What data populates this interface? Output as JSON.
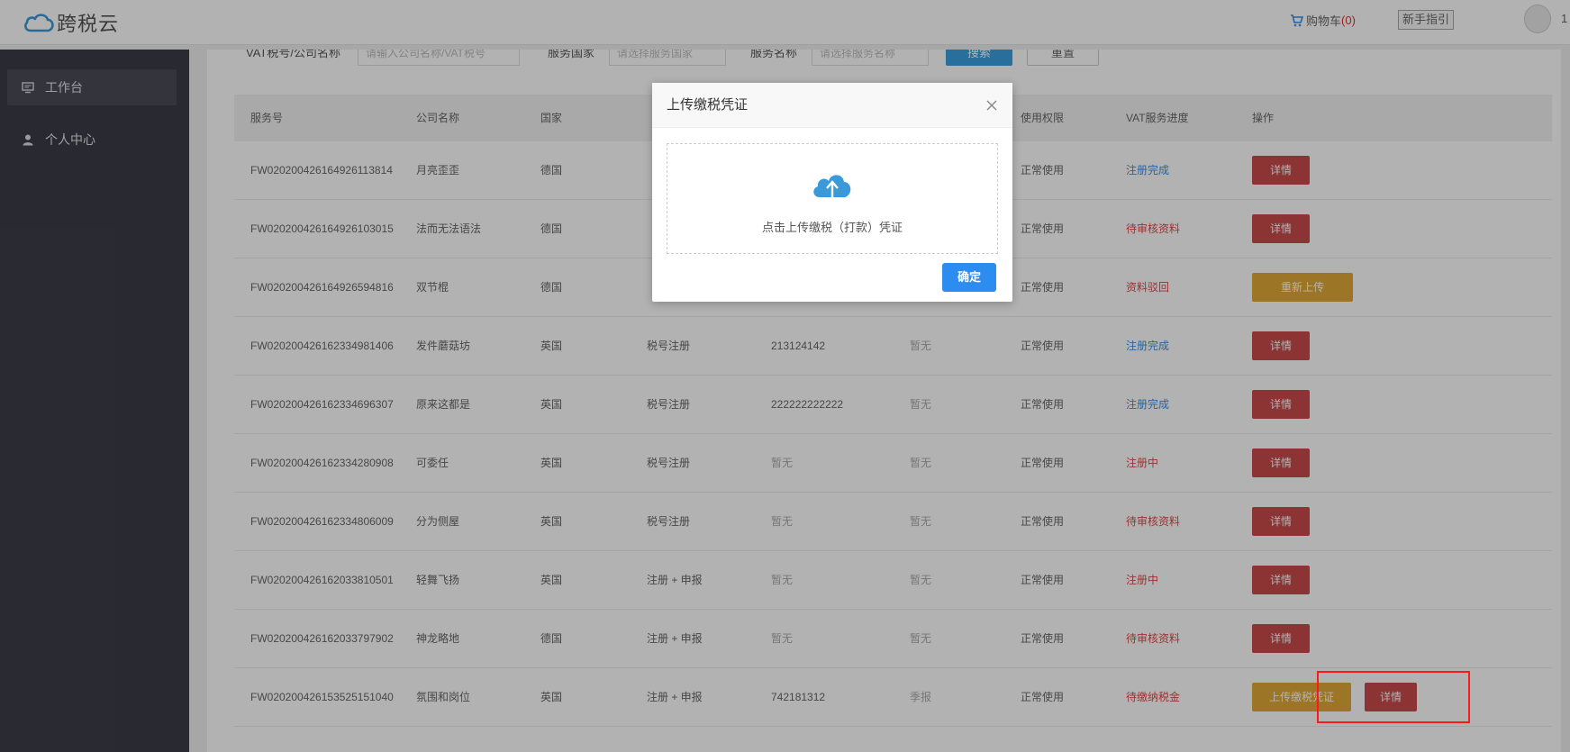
{
  "app": {
    "name": "跨税云"
  },
  "topbar": {
    "cart_label": "购物车",
    "cart_count": "(0)",
    "guide_label": "新手指引",
    "user_num": "1"
  },
  "sidebar": {
    "items": [
      {
        "label": "工作台",
        "active": true
      },
      {
        "label": "个人中心",
        "active": false
      }
    ]
  },
  "filter": {
    "vat_label": "VAT税号/公司名称",
    "vat_placeholder": "请输入公司名称/VAT税号",
    "country_label": "服务国家",
    "country_placeholder": "请选择服务国家",
    "service_label": "服务名称",
    "service_placeholder": "请选择服务名称",
    "search_label": "搜索",
    "reset_label": "重置"
  },
  "table": {
    "columns": [
      "服务号",
      "公司名称",
      "国家",
      "",
      "",
      "",
      "使用权限",
      "VAT服务进度",
      "操作"
    ],
    "rows": [
      {
        "id": "FW020200426164926113814",
        "company": "月亮歪歪",
        "country": "德国",
        "service": "",
        "vat": "",
        "vat_muted": false,
        "report": "",
        "permission": "正常使用",
        "progress": "注册完成",
        "progress_color": "blue",
        "action": "详情"
      },
      {
        "id": "FW020200426164926103015",
        "company": "法而无法语法",
        "country": "德国",
        "service": "",
        "vat": "",
        "vat_muted": false,
        "report": "",
        "permission": "正常使用",
        "progress": "待审核资料",
        "progress_color": "red",
        "action": "详情"
      },
      {
        "id": "FW020200426164926594816",
        "company": "双节棍",
        "country": "德国",
        "service": "",
        "vat": "",
        "vat_muted": false,
        "report": "",
        "permission": "正常使用",
        "progress": "资料驳回",
        "progress_color": "red",
        "action": "重新上传"
      },
      {
        "id": "FW020200426162334981406",
        "company": "发件蘑菇坊",
        "country": "英国",
        "service": "税号注册",
        "vat": "213124142",
        "vat_muted": false,
        "report": "暂无",
        "permission": "正常使用",
        "progress": "注册完成",
        "progress_color": "blue",
        "action": "详情"
      },
      {
        "id": "FW020200426162334696307",
        "company": "原来这都是",
        "country": "英国",
        "service": "税号注册",
        "vat": "222222222222",
        "vat_muted": false,
        "report": "暂无",
        "permission": "正常使用",
        "progress": "注册完成",
        "progress_color": "blue",
        "action": "详情"
      },
      {
        "id": "FW020200426162334280908",
        "company": "可委任",
        "country": "英国",
        "service": "税号注册",
        "vat": "暂无",
        "vat_muted": true,
        "report": "暂无",
        "permission": "正常使用",
        "progress": "注册中",
        "progress_color": "red",
        "action": "详情"
      },
      {
        "id": "FW020200426162334806009",
        "company": "分为侧屋",
        "country": "英国",
        "service": "税号注册",
        "vat": "暂无",
        "vat_muted": true,
        "report": "暂无",
        "permission": "正常使用",
        "progress": "待审核资料",
        "progress_color": "red",
        "action": "详情"
      },
      {
        "id": "FW020200426162033810501",
        "company": "轻舞飞扬",
        "country": "英国",
        "service": "注册 + 申报",
        "vat": "暂无",
        "vat_muted": true,
        "report": "暂无",
        "permission": "正常使用",
        "progress": "注册中",
        "progress_color": "red",
        "action": "详情"
      },
      {
        "id": "FW020200426162033797902",
        "company": "神龙略地",
        "country": "德国",
        "service": "注册 + 申报",
        "vat": "暂无",
        "vat_muted": true,
        "report": "暂无",
        "permission": "正常使用",
        "progress": "待审核资料",
        "progress_color": "red",
        "action": "详情"
      },
      {
        "id": "FW020200426153525151040",
        "company": "氛围和岗位",
        "country": "英国",
        "service": "注册 + 申报",
        "vat": "742181312",
        "vat_muted": false,
        "report": "季报",
        "permission": "正常使用",
        "progress": "待缴纳税金",
        "progress_color": "red",
        "action": "上传缴税凭证",
        "action2": "详情"
      }
    ]
  },
  "modal": {
    "title": "上传缴税凭证",
    "upload_hint": "点击上传缴税（打款）凭证",
    "confirm_label": "确定"
  },
  "colors": {
    "accent": "#2d8cf0",
    "detail_btn": "#c94b4b",
    "upload_btn": "#e0a838",
    "sidebar_bg": "#3c3d47",
    "highlight": "#ff1a1a"
  }
}
